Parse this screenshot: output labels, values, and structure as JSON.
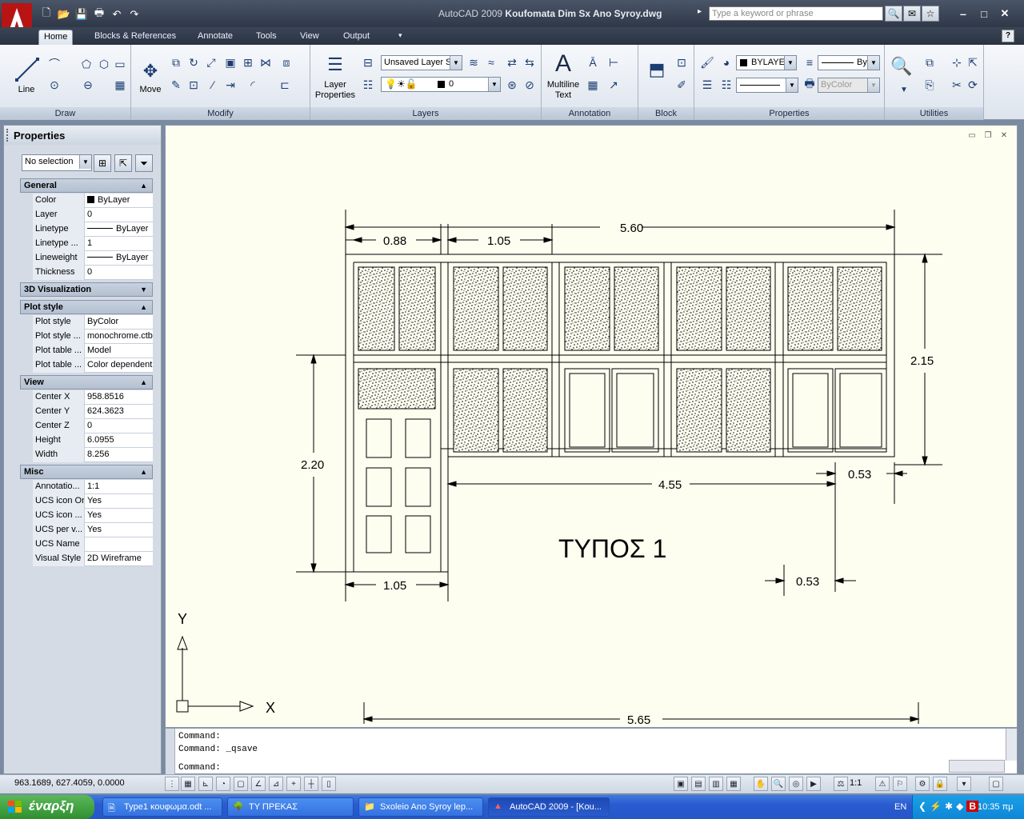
{
  "window": {
    "app_name": "AutoCAD 2009",
    "file_name": "Koufomata Dim Sx Ano Syroy.dwg",
    "search_placeholder": "Type a keyword or phrase"
  },
  "ribbon": {
    "tabs": [
      {
        "label": "Home",
        "active": true
      },
      {
        "label": "Blocks & References",
        "active": false
      },
      {
        "label": "Annotate",
        "active": false
      },
      {
        "label": "Tools",
        "active": false
      },
      {
        "label": "View",
        "active": false
      },
      {
        "label": "Output",
        "active": false
      }
    ],
    "panels": {
      "draw": {
        "title": "Draw",
        "line_label": "Line"
      },
      "modify": {
        "title": "Modify",
        "move_label": "Move"
      },
      "layers": {
        "title": "Layers",
        "layer_properties_label": "Layer Properties",
        "layer_state_value": "Unsaved Layer S",
        "layer_value": "0"
      },
      "annotation": {
        "title": "Annotation",
        "mtext_label": "Multiline Text"
      },
      "block": {
        "title": "Block"
      },
      "properties": {
        "title": "Properties",
        "color_value": "BYLAYER",
        "linetype_value": "ByL",
        "plotstyle_value": "ByColor"
      },
      "utilities": {
        "title": "Utilities"
      }
    }
  },
  "properties_palette": {
    "title": "Properties",
    "selection": "No selection",
    "sections": {
      "general": {
        "title": "General",
        "rows": [
          {
            "name": "Color",
            "value": "ByLayer"
          },
          {
            "name": "Layer",
            "value": "0"
          },
          {
            "name": "Linetype",
            "value": "ByLayer"
          },
          {
            "name": "Linetype ...",
            "value": "1"
          },
          {
            "name": "Lineweight",
            "value": "ByLayer"
          },
          {
            "name": "Thickness",
            "value": "0"
          }
        ]
      },
      "visualization": {
        "title": "3D Visualization"
      },
      "plot_style": {
        "title": "Plot style",
        "rows": [
          {
            "name": "Plot style",
            "value": "ByColor"
          },
          {
            "name": "Plot style ...",
            "value": "monochrome.ctb"
          },
          {
            "name": "Plot table ...",
            "value": "Model"
          },
          {
            "name": "Plot table ...",
            "value": "Color dependent"
          }
        ]
      },
      "view": {
        "title": "View",
        "rows": [
          {
            "name": "Center X",
            "value": "958.8516"
          },
          {
            "name": "Center Y",
            "value": "624.3623"
          },
          {
            "name": "Center Z",
            "value": "0"
          },
          {
            "name": "Height",
            "value": "6.0955"
          },
          {
            "name": "Width",
            "value": "8.256"
          }
        ]
      },
      "misc": {
        "title": "Misc",
        "rows": [
          {
            "name": "Annotatio...",
            "value": "1:1"
          },
          {
            "name": "UCS icon On",
            "value": "Yes"
          },
          {
            "name": "UCS icon ...",
            "value": "Yes"
          },
          {
            "name": "UCS per v...",
            "value": "Yes"
          },
          {
            "name": "UCS Name",
            "value": ""
          },
          {
            "name": "Visual Style",
            "value": "2D Wireframe"
          }
        ]
      }
    }
  },
  "drawing": {
    "label": "ΤΥΠΟΣ 1",
    "dims": {
      "top_total": "5.60",
      "top_left": "0.88",
      "top_second": "1.05",
      "right_height": "2.15",
      "left_height": "2.20",
      "bottom_door": "1.05",
      "mid_width": "4.55",
      "offset_a": "0.53",
      "offset_b": "0.53",
      "bottom_total": "5.65"
    },
    "ucs": {
      "x": "X",
      "y": "Y"
    }
  },
  "command_line": {
    "history": [
      "Command:",
      "Command: _qsave"
    ],
    "prompt": "Command:"
  },
  "status_bar": {
    "coordinates": "963.1689, 627.4059, 0.0000",
    "annotation_scale": "1:1"
  },
  "taskbar": {
    "start_label": "έναρξη",
    "tasks": [
      {
        "label": "Type1 κουφωμα.odt ...",
        "active": false
      },
      {
        "label": "ΤΥ ΠΡΕΚΑΣ",
        "active": false
      },
      {
        "label": "Sxoleio Ano Syroy lep...",
        "active": false
      },
      {
        "label": "AutoCAD 2009 - [Kou...",
        "active": true
      }
    ],
    "language": "EN",
    "clock": "10:35 πμ"
  }
}
